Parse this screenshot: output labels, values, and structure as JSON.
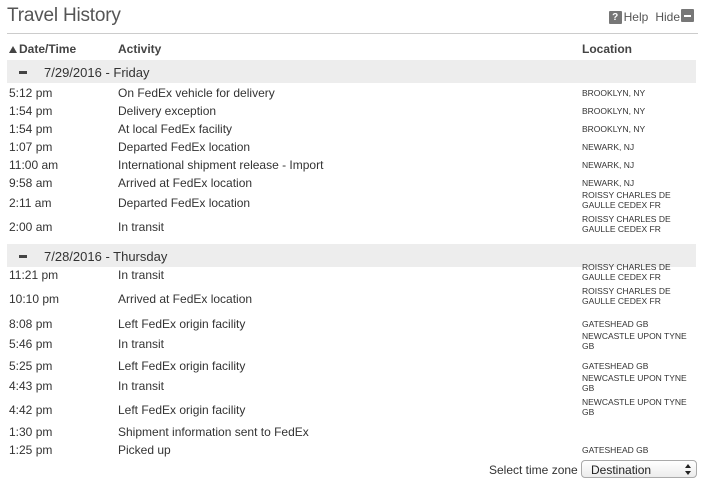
{
  "header": {
    "title": "Travel History",
    "help_label": "Help",
    "hide_label": "Hide",
    "help_icon_glyph": "?"
  },
  "columns": {
    "datetime": "Date/Time",
    "activity": "Activity",
    "location": "Location"
  },
  "groups": [
    {
      "label": "7/29/2016 - Friday",
      "events": [
        {
          "time": "5:12 pm",
          "activity": "On FedEx vehicle for delivery",
          "location": "BROOKLYN, NY"
        },
        {
          "time": "1:54 pm",
          "activity": "Delivery exception",
          "location": "BROOKLYN, NY"
        },
        {
          "time": "1:54 pm",
          "activity": "At local FedEx facility",
          "location": "BROOKLYN, NY"
        },
        {
          "time": "1:07 pm",
          "activity": "Departed FedEx location",
          "location": "NEWARK, NJ"
        },
        {
          "time": "11:00 am",
          "activity": "International shipment release - Import",
          "location": "NEWARK, NJ"
        },
        {
          "time": "9:58 am",
          "activity": "Arrived at FedEx location",
          "location": "NEWARK, NJ"
        },
        {
          "time": "2:11 am",
          "activity": "Departed FedEx location",
          "location": "ROISSY CHARLES DE GAULLE CEDEX FR"
        },
        {
          "time": "2:00 am",
          "activity": "In transit",
          "location": "ROISSY CHARLES DE GAULLE CEDEX FR"
        }
      ]
    },
    {
      "label": "7/28/2016 - Thursday",
      "events": [
        {
          "time": "11:21 pm",
          "activity": "In transit",
          "location": "ROISSY CHARLES DE GAULLE CEDEX FR"
        },
        {
          "time": "10:10 pm",
          "activity": "Arrived at FedEx location",
          "location": "ROISSY CHARLES DE GAULLE CEDEX FR"
        },
        {
          "time": "8:08 pm",
          "activity": "Left FedEx origin facility",
          "location": "GATESHEAD GB"
        },
        {
          "time": "5:46 pm",
          "activity": "In transit",
          "location": "NEWCASTLE UPON TYNE GB"
        },
        {
          "time": "5:25 pm",
          "activity": "Left FedEx origin facility",
          "location": "GATESHEAD GB"
        },
        {
          "time": "4:43 pm",
          "activity": "In transit",
          "location": "NEWCASTLE UPON TYNE GB"
        },
        {
          "time": "4:42 pm",
          "activity": "Left FedEx origin facility",
          "location": "NEWCASTLE UPON TYNE GB"
        },
        {
          "time": "1:30 pm",
          "activity": "Shipment information sent to FedEx",
          "location": ""
        },
        {
          "time": "1:25 pm",
          "activity": "Picked up",
          "location": "GATESHEAD GB"
        }
      ]
    }
  ],
  "footer": {
    "timezone_label": "Select time zone",
    "timezone_value": "Destination"
  }
}
